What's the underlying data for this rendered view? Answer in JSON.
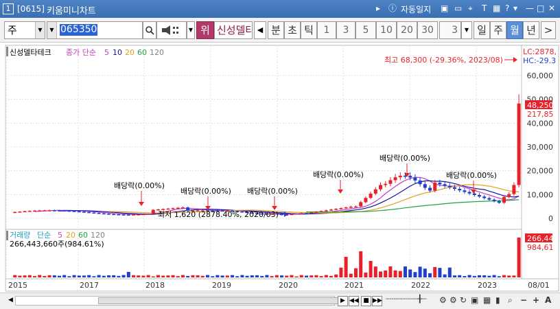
{
  "window": {
    "num": "1",
    "code": "[0615]",
    "title": "키움미니차트",
    "auto_label": "자동일지"
  },
  "toolbar": {
    "period_type": "주",
    "stock_code": "065350",
    "badge": "위",
    "stock_name": "신성델타테크",
    "periods": [
      "분",
      "초",
      "틱"
    ],
    "numbers": [
      "1",
      "3",
      "5",
      "10",
      "20",
      "30"
    ],
    "count": "3",
    "tf": [
      "일",
      "주",
      "월",
      "년"
    ],
    "active_tf": "월"
  },
  "legend": {
    "name": "신성델타테크",
    "ma_label": "종가 단순",
    "ma_periods": [
      "5",
      "10",
      "20",
      "60",
      "120"
    ]
  },
  "volume_legend": {
    "label": "거래량",
    "ma_label": "단순",
    "ma_periods": [
      "5",
      "20",
      "60",
      "120"
    ],
    "current": "266,443,660주(984.61%)"
  },
  "annotations": {
    "high": "최고 68,300 (-29.36%, 2023/08)",
    "low": "최저 1,620 (2878.40%, 2020/03)",
    "dividend": "배당락(0.00%)",
    "lc": "LC:2878,",
    "hc": "HC:-29.3"
  },
  "price_labels": {
    "current": "48,250",
    "sub": "217,85"
  },
  "volume_labels": {
    "current": "266,44",
    "sub": "984,61"
  },
  "colors": {
    "up": "#e8202a",
    "down": "#1f3fcf",
    "ma5": "#c040c0",
    "ma10": "#1010a0",
    "ma20": "#e0a020",
    "ma60": "#20a040",
    "ma120": "#808080"
  },
  "chart_data": {
    "type": "candlestick",
    "y_axis_ticks": [
      "60,000",
      "50,000",
      "40,000",
      "30,000",
      "20,000",
      "10,000",
      "0"
    ],
    "x_axis_ticks": [
      "2015",
      "2017",
      "2018",
      "2019",
      "2020",
      "2021",
      "2022",
      "2023",
      "08/01"
    ],
    "ylim": [
      0,
      70000
    ],
    "volume_label_right": "266,44"
  }
}
